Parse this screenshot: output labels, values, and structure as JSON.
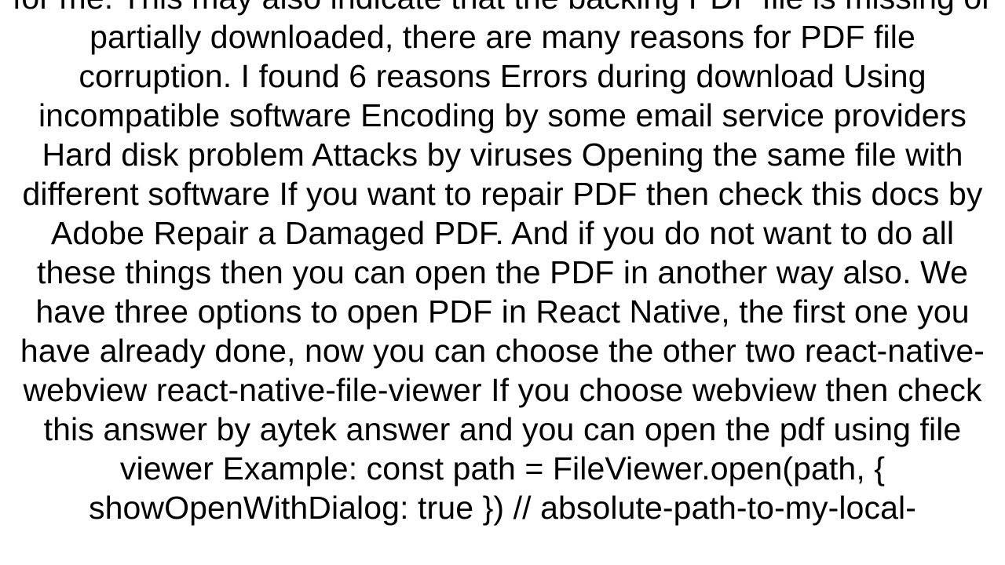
{
  "document": {
    "body_text": "for me. This may also indicate that the backing PDF file is missing or partially downloaded, there are many reasons for PDF file corruption. I found 6 reasons  Errors during download Using incompatible software Encoding by some email service providers Hard disk problem Attacks by viruses Opening the same file with different software  If you want to repair PDF then check this docs by Adobe Repair a Damaged PDF. And if you do not want to do all these things then you can open the PDF in another way also. We have three options to open PDF in React Native, the first one you have already done, now you can choose the other two  react-native-webview react-native-file-viewer   If you choose webview then check this answer by aytek answer and you can open the pdf using file viewer Example:  const path = FileViewer.open(path, { showOpenWithDialog: true }) // absolute-path-to-my-local-"
  }
}
